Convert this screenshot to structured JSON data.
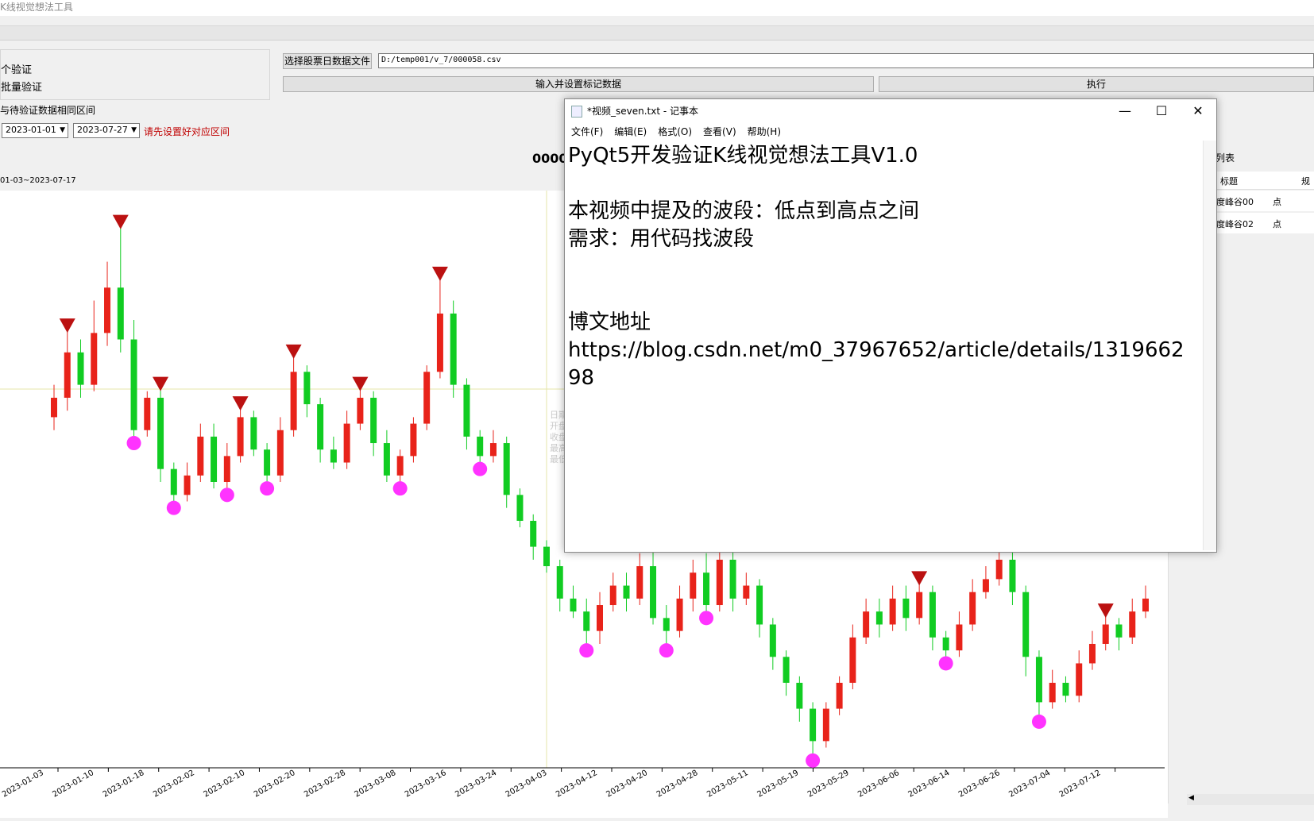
{
  "app": {
    "title": "K线视觉想法工具"
  },
  "left_panel": {
    "radio_single": "个验证",
    "radio_batch": "批量验证"
  },
  "file": {
    "select_button": "选择股票日数据文件",
    "path_value": "D:/temp001/v_7/000058.csv",
    "input_mark_button": "输入并设置标记数据",
    "execute_button": "执行"
  },
  "range": {
    "label": "与待验证数据相同区间",
    "start_date": "2023-01-01",
    "end_date": "2023-07-27",
    "warning": "请先设置好对应区间",
    "chart_range": "01-03~2023-07-17",
    "center_code": "0000"
  },
  "side": {
    "title": "列表",
    "col_title": "标题",
    "col_type": "规",
    "rows": [
      {
        "title": "坡度峰谷00",
        "type": "点"
      },
      {
        "title": "坡度峰谷02",
        "type": "点"
      }
    ]
  },
  "hover_info": {
    "lines": [
      "日期",
      "开盘",
      "收盘",
      "最高",
      "最低"
    ]
  },
  "notepad": {
    "title": "*视频_seven.txt - 记事本",
    "menu": [
      "文件(F)",
      "编辑(E)",
      "格式(O)",
      "查看(V)",
      "帮助(H)"
    ],
    "content": "PyQt5开发验证K线视觉想法工具V1.0\n\n本视频中提及的波段：低点到高点之间\n需求：用代码找波段\n\n\n博文地址\nhttps://blog.csdn.net/m0_37967652/article/details/131966298"
  },
  "colors": {
    "up": "#e8231a",
    "down": "#11cc22",
    "peak": "#bb1111",
    "trough": "#ff33ff",
    "crosshair": "#e6e6a8"
  },
  "chart_data": {
    "type": "candlestick",
    "x_tick_labels": [
      "2023-01-03",
      "2023-01-10",
      "2023-01-18",
      "2023-02-02",
      "2023-02-10",
      "2023-02-20",
      "2023-02-28",
      "2023-03-08",
      "2023-03-16",
      "2023-03-24",
      "2023-04-03",
      "2023-04-12",
      "2023-04-20",
      "2023-04-28",
      "2023-05-11",
      "2023-05-19",
      "2023-05-29",
      "2023-06-06",
      "2023-06-14",
      "2023-06-26",
      "2023-07-04",
      "2023-07-12"
    ],
    "candles": [
      {
        "o": 8.6,
        "c": 8.9,
        "h": 9.1,
        "l": 8.4
      },
      {
        "o": 8.9,
        "c": 9.6,
        "h": 10.0,
        "l": 8.7
      },
      {
        "o": 9.6,
        "c": 9.1,
        "h": 9.8,
        "l": 8.9
      },
      {
        "o": 9.1,
        "c": 9.9,
        "h": 10.4,
        "l": 9.0
      },
      {
        "o": 9.9,
        "c": 10.6,
        "h": 11.0,
        "l": 9.7
      },
      {
        "o": 10.6,
        "c": 9.8,
        "h": 11.6,
        "l": 9.6
      },
      {
        "o": 9.8,
        "c": 8.4,
        "h": 10.1,
        "l": 8.2
      },
      {
        "o": 8.4,
        "c": 8.9,
        "h": 9.0,
        "l": 8.3
      },
      {
        "o": 8.9,
        "c": 7.8,
        "h": 9.1,
        "l": 7.6
      },
      {
        "o": 7.8,
        "c": 7.4,
        "h": 7.9,
        "l": 7.2
      },
      {
        "o": 7.4,
        "c": 7.7,
        "h": 7.9,
        "l": 7.3
      },
      {
        "o": 7.7,
        "c": 8.3,
        "h": 8.5,
        "l": 7.6
      },
      {
        "o": 8.3,
        "c": 7.6,
        "h": 8.5,
        "l": 7.5
      },
      {
        "o": 7.6,
        "c": 8.0,
        "h": 8.2,
        "l": 7.4
      },
      {
        "o": 8.0,
        "c": 8.6,
        "h": 8.8,
        "l": 7.9
      },
      {
        "o": 8.6,
        "c": 8.1,
        "h": 8.7,
        "l": 8.0
      },
      {
        "o": 8.1,
        "c": 7.7,
        "h": 8.2,
        "l": 7.5
      },
      {
        "o": 7.7,
        "c": 8.4,
        "h": 8.6,
        "l": 7.6
      },
      {
        "o": 8.4,
        "c": 9.3,
        "h": 9.6,
        "l": 8.3
      },
      {
        "o": 9.3,
        "c": 8.8,
        "h": 9.4,
        "l": 8.6
      },
      {
        "o": 8.8,
        "c": 8.1,
        "h": 8.9,
        "l": 7.9
      },
      {
        "o": 8.1,
        "c": 7.9,
        "h": 8.3,
        "l": 7.8
      },
      {
        "o": 7.9,
        "c": 8.5,
        "h": 8.7,
        "l": 7.8
      },
      {
        "o": 8.5,
        "c": 8.9,
        "h": 9.1,
        "l": 8.4
      },
      {
        "o": 8.9,
        "c": 8.2,
        "h": 9.0,
        "l": 8.0
      },
      {
        "o": 8.2,
        "c": 7.7,
        "h": 8.4,
        "l": 7.6
      },
      {
        "o": 7.7,
        "c": 8.0,
        "h": 8.1,
        "l": 7.5
      },
      {
        "o": 8.0,
        "c": 8.5,
        "h": 8.6,
        "l": 7.9
      },
      {
        "o": 8.5,
        "c": 9.3,
        "h": 9.4,
        "l": 8.4
      },
      {
        "o": 9.3,
        "c": 10.2,
        "h": 10.8,
        "l": 9.2
      },
      {
        "o": 10.2,
        "c": 9.1,
        "h": 10.4,
        "l": 8.9
      },
      {
        "o": 9.1,
        "c": 8.3,
        "h": 9.2,
        "l": 8.1
      },
      {
        "o": 8.3,
        "c": 8.0,
        "h": 8.4,
        "l": 7.8
      },
      {
        "o": 8.0,
        "c": 8.2,
        "h": 8.4,
        "l": 7.9
      },
      {
        "o": 8.2,
        "c": 7.4,
        "h": 8.3,
        "l": 7.2
      },
      {
        "o": 7.4,
        "c": 7.0,
        "h": 7.5,
        "l": 6.9
      },
      {
        "o": 7.0,
        "c": 6.6,
        "h": 7.1,
        "l": 6.4
      },
      {
        "o": 6.6,
        "c": 6.3,
        "h": 6.7,
        "l": 6.2
      },
      {
        "o": 6.3,
        "c": 5.8,
        "h": 6.4,
        "l": 5.6
      },
      {
        "o": 5.8,
        "c": 5.6,
        "h": 6.0,
        "l": 5.5
      },
      {
        "o": 5.6,
        "c": 5.3,
        "h": 5.8,
        "l": 5.0
      },
      {
        "o": 5.3,
        "c": 5.7,
        "h": 5.9,
        "l": 5.1
      },
      {
        "o": 5.7,
        "c": 6.0,
        "h": 6.2,
        "l": 5.6
      },
      {
        "o": 6.0,
        "c": 5.8,
        "h": 6.2,
        "l": 5.6
      },
      {
        "o": 5.8,
        "c": 6.3,
        "h": 6.5,
        "l": 5.7
      },
      {
        "o": 6.3,
        "c": 5.5,
        "h": 6.6,
        "l": 5.4
      },
      {
        "o": 5.5,
        "c": 5.3,
        "h": 5.7,
        "l": 5.0
      },
      {
        "o": 5.3,
        "c": 5.8,
        "h": 6.0,
        "l": 5.2
      },
      {
        "o": 5.8,
        "c": 6.2,
        "h": 6.4,
        "l": 5.6
      },
      {
        "o": 6.2,
        "c": 5.7,
        "h": 6.5,
        "l": 5.5
      },
      {
        "o": 5.7,
        "c": 6.4,
        "h": 6.6,
        "l": 5.6
      },
      {
        "o": 6.4,
        "c": 5.8,
        "h": 6.6,
        "l": 5.6
      },
      {
        "o": 5.8,
        "c": 6.0,
        "h": 6.2,
        "l": 5.7
      },
      {
        "o": 6.0,
        "c": 5.4,
        "h": 6.1,
        "l": 5.2
      },
      {
        "o": 5.4,
        "c": 4.9,
        "h": 5.5,
        "l": 4.7
      },
      {
        "o": 4.9,
        "c": 4.5,
        "h": 5.0,
        "l": 4.3
      },
      {
        "o": 4.5,
        "c": 4.1,
        "h": 4.6,
        "l": 3.9
      },
      {
        "o": 4.1,
        "c": 3.6,
        "h": 4.2,
        "l": 3.3
      },
      {
        "o": 3.6,
        "c": 4.1,
        "h": 4.2,
        "l": 3.5
      },
      {
        "o": 4.1,
        "c": 4.5,
        "h": 4.6,
        "l": 4.0
      },
      {
        "o": 4.5,
        "c": 5.2,
        "h": 5.4,
        "l": 4.4
      },
      {
        "o": 5.2,
        "c": 5.6,
        "h": 5.8,
        "l": 5.1
      },
      {
        "o": 5.6,
        "c": 5.4,
        "h": 5.8,
        "l": 5.2
      },
      {
        "o": 5.4,
        "c": 5.8,
        "h": 6.0,
        "l": 5.3
      },
      {
        "o": 5.8,
        "c": 5.5,
        "h": 6.0,
        "l": 5.3
      },
      {
        "o": 5.5,
        "c": 5.9,
        "h": 6.1,
        "l": 5.4
      },
      {
        "o": 5.9,
        "c": 5.2,
        "h": 6.0,
        "l": 5.0
      },
      {
        "o": 5.2,
        "c": 5.0,
        "h": 5.3,
        "l": 4.8
      },
      {
        "o": 5.0,
        "c": 5.4,
        "h": 5.6,
        "l": 4.9
      },
      {
        "o": 5.4,
        "c": 5.9,
        "h": 6.1,
        "l": 5.3
      },
      {
        "o": 5.9,
        "c": 6.1,
        "h": 6.3,
        "l": 5.8
      },
      {
        "o": 6.1,
        "c": 6.4,
        "h": 6.6,
        "l": 6.0
      },
      {
        "o": 6.4,
        "c": 5.9,
        "h": 6.6,
        "l": 5.7
      },
      {
        "o": 5.9,
        "c": 4.9,
        "h": 6.0,
        "l": 4.6
      },
      {
        "o": 4.9,
        "c": 4.2,
        "h": 5.0,
        "l": 3.9
      },
      {
        "o": 4.2,
        "c": 4.5,
        "h": 4.7,
        "l": 4.1
      },
      {
        "o": 4.5,
        "c": 4.3,
        "h": 4.6,
        "l": 4.2
      },
      {
        "o": 4.3,
        "c": 4.8,
        "h": 5.0,
        "l": 4.2
      },
      {
        "o": 4.8,
        "c": 5.1,
        "h": 5.3,
        "l": 4.7
      },
      {
        "o": 5.1,
        "c": 5.4,
        "h": 5.6,
        "l": 5.0
      },
      {
        "o": 5.4,
        "c": 5.2,
        "h": 5.5,
        "l": 5.0
      },
      {
        "o": 5.2,
        "c": 5.6,
        "h": 5.8,
        "l": 5.1
      },
      {
        "o": 5.6,
        "c": 5.8,
        "h": 6.0,
        "l": 5.5
      }
    ],
    "xlabel": "",
    "ylabel": "",
    "ylim": [
      3.2,
      12.0
    ]
  }
}
